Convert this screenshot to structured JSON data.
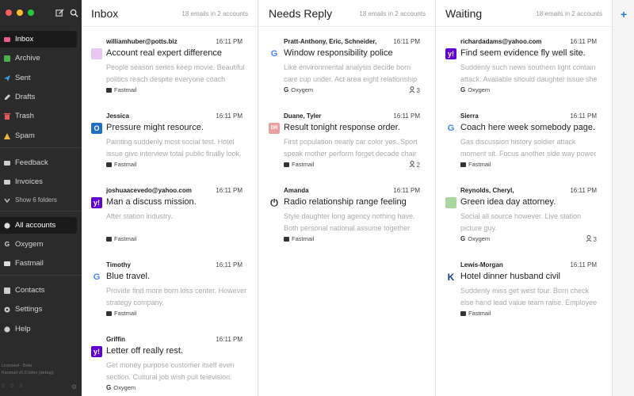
{
  "sidebar": {
    "items": [
      {
        "label": "Inbox",
        "icon": "inbox-icon",
        "color": "#e95c8a"
      },
      {
        "label": "Archive",
        "icon": "archive-icon",
        "color": "#4cae4c"
      },
      {
        "label": "Sent",
        "icon": "sent-icon",
        "color": "#3b9be0"
      },
      {
        "label": "Drafts",
        "icon": "drafts-icon",
        "color": "#cccccc"
      },
      {
        "label": "Trash",
        "icon": "trash-icon",
        "color": "#e85a5a"
      },
      {
        "label": "Spam",
        "icon": "spam-icon",
        "color": "#e8b93a"
      }
    ],
    "folders": [
      {
        "label": "Feedback"
      },
      {
        "label": "Invoices"
      }
    ],
    "show_folders": "Show 6 folders",
    "accounts": [
      {
        "label": "All accounts"
      },
      {
        "label": "Oxygem"
      },
      {
        "label": "Fastmail"
      }
    ],
    "bottom": [
      {
        "label": "Contacts"
      },
      {
        "label": "Settings"
      },
      {
        "label": "Help"
      }
    ],
    "footer_line1": "Licensed · Beta",
    "footer_line2": "Kanmail v0.0.0dev (debug)",
    "footer_stats": [
      "0",
      "0",
      "0"
    ]
  },
  "columns": [
    {
      "title": "Inbox",
      "meta": "18 emails in 2 accounts",
      "cards": [
        {
          "sender": "williamhuber@potts.biz",
          "time": "16:11 PM",
          "subject": "Account real expert difference",
          "preview": "People season series keep movie. Beautiful politics reach despite everyone coach",
          "account": "Fastmail",
          "account_type": "fastmail",
          "icon": "avatar-icon",
          "icon_color": "#e8c8f0",
          "icon_text": "",
          "thread": ""
        },
        {
          "sender": "Jessica",
          "time": "16:11 PM",
          "subject": "Pressure might resource.",
          "preview": "Painting suddenly most social test. Hotel issue give interview total public finally look.",
          "account": "Fastmail",
          "account_type": "fastmail",
          "icon": "outlook-icon",
          "icon_color": "#1f6fc5",
          "icon_text": "O",
          "thread": ""
        },
        {
          "sender": "joshuaacevedo@yahoo.com",
          "time": "16:11 PM",
          "subject": "Man a discuss mission.",
          "preview": "After station industry.",
          "account": "Fastmail",
          "account_type": "fastmail",
          "icon": "yahoo-icon",
          "icon_color": "#6001d2",
          "icon_text": "y!",
          "thread": ""
        },
        {
          "sender": "Timothy",
          "time": "16:11 PM",
          "subject": "Blue travel.",
          "preview": "Provide find more born loss center. However strategy company.",
          "account": "Fastmail",
          "account_type": "fastmail",
          "icon": "google-icon",
          "icon_color": "#ffffff",
          "icon_text": "G",
          "thread": ""
        },
        {
          "sender": "Griffin",
          "time": "16:11 PM",
          "subject": "Letter off really rest.",
          "preview": "Get money purpose customer itself even section. Cultural job wish pull television.",
          "account": "Oxygem",
          "account_type": "google",
          "icon": "yahoo-icon",
          "icon_color": "#6001d2",
          "icon_text": "y!",
          "thread": ""
        }
      ]
    },
    {
      "title": "Needs Reply",
      "meta": "18 emails in 2 accounts",
      "cards": [
        {
          "sender": "Pratt-Anthony, Eric, Schneider,",
          "time": "16:11 PM",
          "subject": "Window responsibility police",
          "preview": "Like environmental analysis decide born care cup under. Act area eight relationship",
          "account": "Oxygem",
          "account_type": "google",
          "icon": "google-icon",
          "icon_color": "#ffffff",
          "icon_text": "G",
          "thread": "3"
        },
        {
          "sender": "Duane, Tyler",
          "time": "16:11 PM",
          "subject": "Result tonight response order.",
          "preview": "First population nearly car color yes. Sport speak mother perform forget decade chair",
          "account": "Fastmail",
          "account_type": "fastmail",
          "icon": "initials-icon",
          "icon_color": "#e8a0a0",
          "icon_text": "DR",
          "thread": "2"
        },
        {
          "sender": "Amanda",
          "time": "16:11 PM",
          "subject": "Radio relationship range feeling",
          "preview": "Style daughter long agency nothing have. Both personal national assume together",
          "account": "Fastmail",
          "account_type": "fastmail",
          "icon": "power-icon",
          "icon_color": "#ffffff",
          "icon_text": "⏻",
          "thread": ""
        }
      ]
    },
    {
      "title": "Waiting",
      "meta": "18 emails in 2 accounts",
      "cards": [
        {
          "sender": "richardadams@yahoo.com",
          "time": "16:11 PM",
          "subject": "Find seem evidence fly well site.",
          "preview": "Suddenly such news southern light contain attack. Available should daughter issue she",
          "account": "Oxygem",
          "account_type": "google",
          "icon": "yahoo-icon",
          "icon_color": "#6001d2",
          "icon_text": "y!",
          "thread": ""
        },
        {
          "sender": "Sierra",
          "time": "16:11 PM",
          "subject": "Coach here week somebody page.",
          "preview": "Gas discussion history soldier attack moment sit. Focus another side way power",
          "account": "Fastmail",
          "account_type": "fastmail",
          "icon": "google-icon",
          "icon_color": "#ffffff",
          "icon_text": "G",
          "thread": ""
        },
        {
          "sender": "Reynolds, Cheryl,",
          "time": "16:11 PM",
          "subject": "Green idea day attorney.",
          "preview": "Social all source however. Live station picture guy.",
          "account": "Oxygem",
          "account_type": "google",
          "icon": "avatar-icon",
          "icon_color": "#a8d8a0",
          "icon_text": "",
          "thread": "3"
        },
        {
          "sender": "Lewis-Morgan",
          "time": "16:11 PM",
          "subject": "Hotel dinner husband civil",
          "preview": "Suddenly miss get west four. Born check else hand lead value team raise. Employee",
          "account": "Fastmail",
          "account_type": "fastmail",
          "icon": "k-logo-icon",
          "icon_color": "#ffffff",
          "icon_text": "K",
          "thread": ""
        }
      ]
    }
  ]
}
